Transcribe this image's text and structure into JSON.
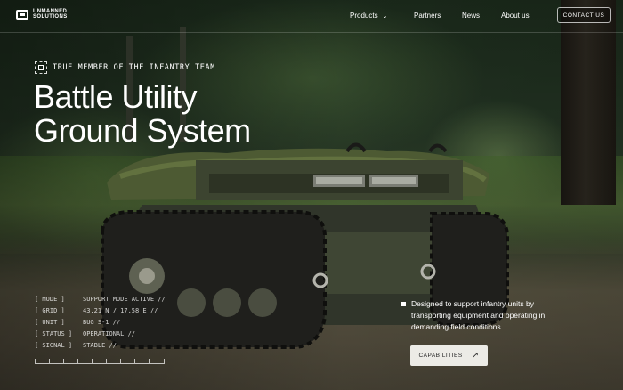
{
  "brand": {
    "name_line1": "UNMANNED",
    "name_line2": "SOLUTIONS"
  },
  "nav": {
    "items": [
      {
        "label": "Products",
        "has_dropdown": true
      },
      {
        "label": "Partners"
      },
      {
        "label": "News"
      },
      {
        "label": "About us"
      }
    ],
    "contact_label": "CONTACT US"
  },
  "hero": {
    "tagline": "TRUE MEMBER OF THE INFANTRY TEAM",
    "title_line1": "Battle Utility",
    "title_line2": "Ground System",
    "description": "Designed to support infantry units by transporting equipment and operating in demanding field conditions.",
    "cta_label": "CAPABILITIES"
  },
  "telemetry": [
    {
      "key": "[ MODE ]",
      "value": "SUPPORT MODE ACTIVE //"
    },
    {
      "key": "[ GRID ]",
      "value": "43.21 N / 17.58 E //"
    },
    {
      "key": "[ UNIT ]",
      "value": "BUG S-1 //"
    },
    {
      "key": "[ STATUS ]",
      "value": "OPERATIONAL //"
    },
    {
      "key": "[ SIGNAL ]",
      "value": "STABLE //"
    }
  ],
  "icons": {
    "logo": "logo-icon",
    "dropdown": "chevron-down-icon",
    "tag": "target-frame-icon",
    "cta": "arrow-up-right-icon"
  },
  "colors": {
    "button_bg": "#ecebe6",
    "button_text": "#222222"
  }
}
